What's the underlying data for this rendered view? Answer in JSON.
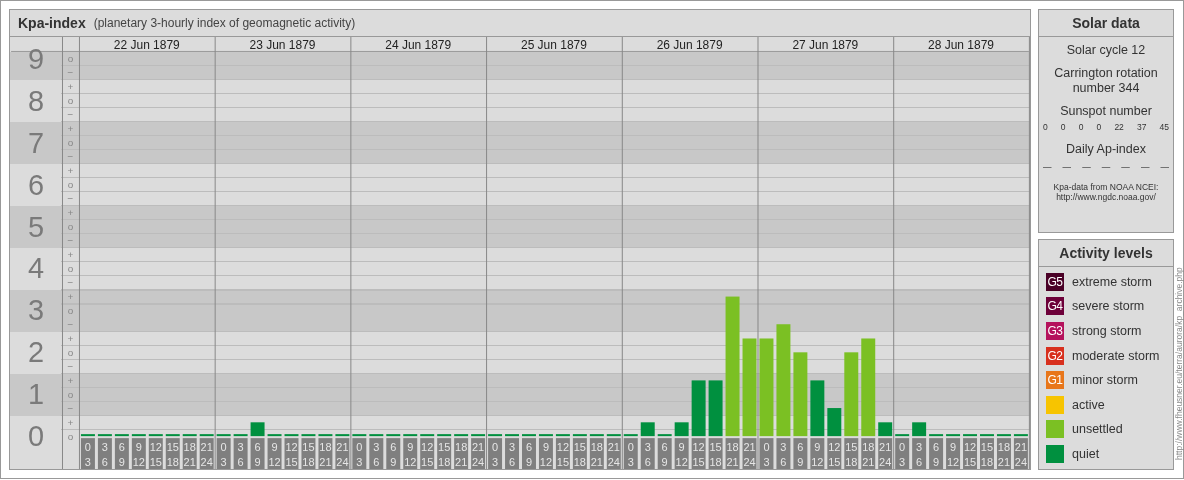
{
  "kpa": {
    "title": "Kpa-index",
    "subtitle": "(planetary 3-hourly index of geomagnetic activity)",
    "days": [
      "22 Jun 1879",
      "23 Jun 1879",
      "24 Jun 1879",
      "25 Jun 1879",
      "26 Jun 1879",
      "27 Jun 1879",
      "28 Jun 1879"
    ],
    "sublevel_marks": [
      "o",
      "−",
      "+",
      "o",
      "−",
      "+",
      "o",
      "−",
      "+",
      "o",
      "−",
      "+",
      "o",
      "−",
      "+",
      "o",
      "−",
      "+",
      "o",
      "−",
      "+",
      "o",
      "−",
      "+",
      "o",
      "−",
      "+",
      "o"
    ],
    "chart_data": {
      "type": "bar",
      "ylim": [
        0,
        9
      ],
      "yticks": [
        0,
        1,
        2,
        3,
        4,
        5,
        6,
        7,
        8,
        9
      ],
      "grid": true,
      "categories": [
        "0 3",
        "3 6",
        "6 9",
        "9 12",
        "12 15",
        "15 18",
        "18 21",
        "21 24",
        "0 3",
        "3 6",
        "6 9",
        "9 12",
        "12 15",
        "15 18",
        "18 21",
        "21 24",
        "0 3",
        "3 6",
        "6 9",
        "9 12",
        "12 15",
        "15 18",
        "18 21",
        "21 24",
        "0 3",
        "3 6",
        "6 9",
        "9 12",
        "12 15",
        "15 18",
        "18 21",
        "21 24",
        "0 3",
        "3 6",
        "6 9",
        "9 12",
        "12 15",
        "15 18",
        "18 21",
        "21 24",
        "0 3",
        "3 6",
        "6 9",
        "9 12",
        "12 15",
        "15 18",
        "18 21",
        "21 24",
        "0 3",
        "3 6",
        "6 9",
        "9 12",
        "12 15",
        "15 18",
        "18 21",
        "21 24"
      ],
      "series": [
        {
          "color": "#00903f",
          "values": [
            0,
            0,
            0,
            0,
            0,
            0,
            0,
            0,
            0,
            0,
            0.33,
            0,
            0,
            0,
            0,
            0,
            0,
            0,
            0,
            0,
            0,
            0,
            0,
            0,
            0,
            0,
            0,
            0,
            0,
            0,
            0,
            0,
            0,
            0.33,
            0,
            0.33,
            1.33,
            1.33,
            null,
            null,
            null,
            null,
            null,
            1.33,
            0.67,
            null,
            null,
            0.33,
            0,
            0.33,
            0,
            0,
            0,
            0,
            0,
            0
          ]
        },
        {
          "color": "#7bc023",
          "values": [
            null,
            null,
            null,
            null,
            null,
            null,
            null,
            null,
            null,
            null,
            null,
            null,
            null,
            null,
            null,
            null,
            null,
            null,
            null,
            null,
            null,
            null,
            null,
            null,
            null,
            null,
            null,
            null,
            null,
            null,
            null,
            null,
            null,
            null,
            null,
            null,
            null,
            null,
            3.33,
            2.33,
            2.33,
            2.67,
            2,
            null,
            null,
            2,
            2.33,
            null,
            null,
            null,
            null,
            null,
            null,
            null,
            null,
            null
          ]
        }
      ]
    }
  },
  "solar": {
    "title": "Solar data",
    "cycle": "Solar cycle 12",
    "carrington": "Carrington rotation number 344",
    "sunspot_label": "Sunspot number",
    "sunspot_numbers": [
      "0",
      "0",
      "0",
      "0",
      "22",
      "37",
      "45"
    ],
    "ap_label": "Daily Ap-index",
    "ap_values": [
      "—",
      "—",
      "—",
      "—",
      "—",
      "—",
      "—"
    ],
    "source": "Kpa-data from NOAA NCEI:",
    "source_url": "http://www.ngdc.noaa.gov/"
  },
  "legend": {
    "title": "Activity levels",
    "items": [
      {
        "badge": "G5",
        "label": "extreme storm",
        "color": "#4a0026"
      },
      {
        "badge": "G4",
        "label": "severe storm",
        "color": "#6d0039"
      },
      {
        "badge": "G3",
        "label": "strong storm",
        "color": "#b5125c"
      },
      {
        "badge": "G2",
        "label": "moderate storm",
        "color": "#d8301e"
      },
      {
        "badge": "G1",
        "label": "minor storm",
        "color": "#e8761a"
      },
      {
        "label": "active",
        "color": "#f7c400"
      },
      {
        "label": "unsettled",
        "color": "#7bc023"
      },
      {
        "label": "quiet",
        "color": "#00903f"
      }
    ]
  },
  "credit": "http://www.fheusner.eu/terra/aurora/kp_archive.php"
}
